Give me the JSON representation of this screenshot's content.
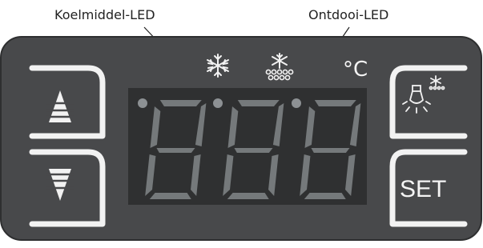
{
  "callouts": {
    "cooling_led": "Koelmiddel-LED",
    "defrost_led": "Ontdooi-LED"
  },
  "display": {
    "unit": "°C",
    "digits": [
      "8",
      "8",
      "8"
    ],
    "leds": [
      {
        "name": "led-1",
        "on": true
      },
      {
        "name": "cooling-led",
        "on": true
      },
      {
        "name": "defrost-led",
        "on": true
      }
    ]
  },
  "buttons": {
    "up": {
      "icon": "triangle-up-icon"
    },
    "down": {
      "icon": "triangle-down-icon"
    },
    "light": {
      "icon": "light-bulb-snow-icon"
    },
    "set": {
      "label": "SET"
    }
  },
  "icons": {
    "cooling": "snowflake-icon",
    "defrost": "snowflake-drops-icon"
  },
  "colors": {
    "panel": "#48494b",
    "panel_edge": "#2e2f30",
    "display_bg": "#2f3031",
    "segment": "#75797b",
    "led": "#8d9194",
    "line": "#f2f2f2"
  }
}
